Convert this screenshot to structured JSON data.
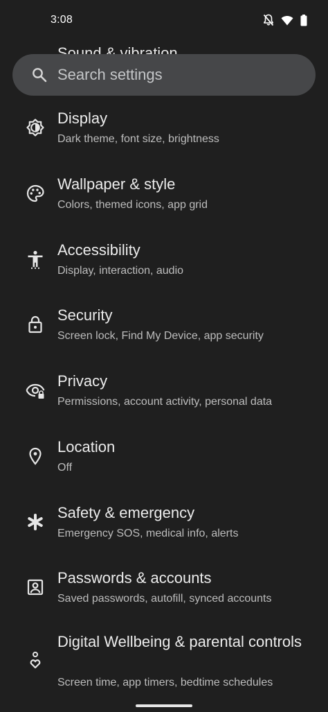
{
  "status_bar": {
    "time": "3:08"
  },
  "partial_item": {
    "title": "Sound & vibration"
  },
  "search": {
    "placeholder": "Search settings"
  },
  "settings": {
    "items": [
      {
        "title": "Display",
        "subtitle": "Dark theme, font size, brightness",
        "icon": "display-brightness-icon"
      },
      {
        "title": "Wallpaper & style",
        "subtitle": "Colors, themed icons, app grid",
        "icon": "palette-icon"
      },
      {
        "title": "Accessibility",
        "subtitle": "Display, interaction, audio",
        "icon": "accessibility-icon"
      },
      {
        "title": "Security",
        "subtitle": "Screen lock, Find My Device, app security",
        "icon": "lock-icon"
      },
      {
        "title": "Privacy",
        "subtitle": "Permissions, account activity, personal data",
        "icon": "privacy-eye-icon"
      },
      {
        "title": "Location",
        "subtitle": "Off",
        "icon": "location-pin-icon"
      },
      {
        "title": "Safety & emergency",
        "subtitle": "Emergency SOS, medical info, alerts",
        "icon": "asterisk-icon"
      },
      {
        "title": "Passwords & accounts",
        "subtitle": "Saved passwords, autofill, synced accounts",
        "icon": "account-box-icon"
      },
      {
        "title": "Digital Wellbeing & parental controls",
        "subtitle": "Screen time, app timers, bedtime schedules",
        "icon": "wellbeing-icon"
      }
    ]
  }
}
